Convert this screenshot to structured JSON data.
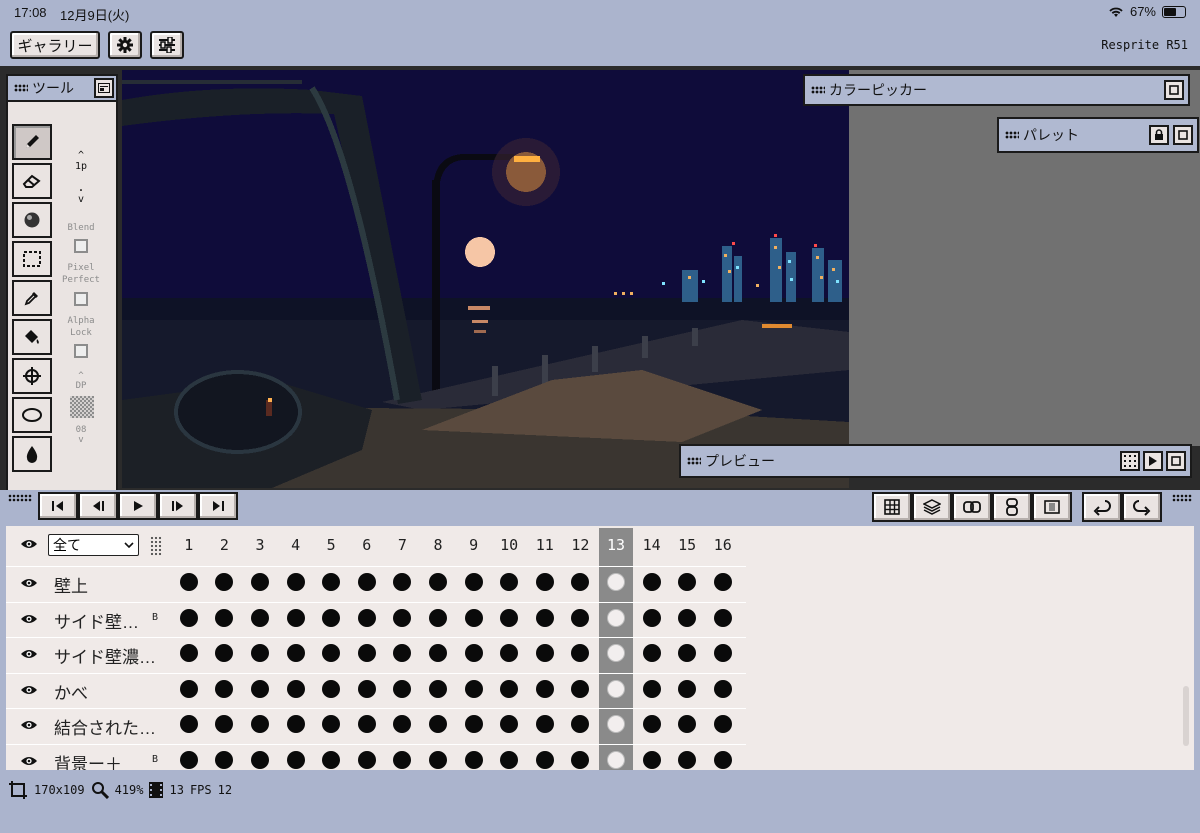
{
  "status_bar": {
    "time": "17:08",
    "date": "12月9日(火)",
    "battery": "67%",
    "battery_level": 0.67
  },
  "top_bar": {
    "gallery_label": "ギャラリー",
    "settings_icon": "gear-icon",
    "adjust_icon": "sliders-icon",
    "app_version": "Resprite R51"
  },
  "tools_panel": {
    "title": "ツール",
    "tools": [
      "pencil-icon",
      "eraser-icon",
      "shade-icon",
      "selection-icon",
      "eyedropper-icon",
      "fill-bucket-icon",
      "move-icon",
      "ellipse-icon",
      "blur-drop-icon"
    ],
    "selected_tool": "pencil-icon",
    "brush_size": "1p",
    "size_dot": ".",
    "blend_label": "Blend",
    "pixel_perfect_label_1": "Pixel",
    "pixel_perfect_label_2": "Perfect",
    "alpha_lock_label_1": "Alpha",
    "alpha_lock_label_2": "Lock",
    "dp_label": "DP",
    "dp_value": "08"
  },
  "color_picker_panel": {
    "title": "カラーピッカー"
  },
  "palette_panel": {
    "title": "パレット"
  },
  "preview_panel": {
    "title": "プレビュー"
  },
  "timeline": {
    "filter_value": "全て",
    "frames": [
      "1",
      "2",
      "3",
      "4",
      "5",
      "6",
      "7",
      "8",
      "9",
      "10",
      "11",
      "12",
      "13",
      "14",
      "15",
      "16"
    ],
    "current_frame": "13",
    "layers": [
      {
        "name": "壁上",
        "badge": ""
      },
      {
        "name": "サイド壁…",
        "badge": "B"
      },
      {
        "name": "サイド壁濃…",
        "badge": ""
      },
      {
        "name": "かべ",
        "badge": ""
      },
      {
        "name": "結合された…",
        "badge": ""
      },
      {
        "name": "背景ー＋",
        "badge": "B"
      }
    ]
  },
  "footer": {
    "canvas_size": "170x109",
    "zoom": "419%",
    "frame_count": "13",
    "fps_label": "FPS",
    "fps_value": "12"
  },
  "colors": {
    "background": "#abb4cd",
    "panel": "#eae4e2",
    "accent_frame": "#8a8a8a"
  }
}
